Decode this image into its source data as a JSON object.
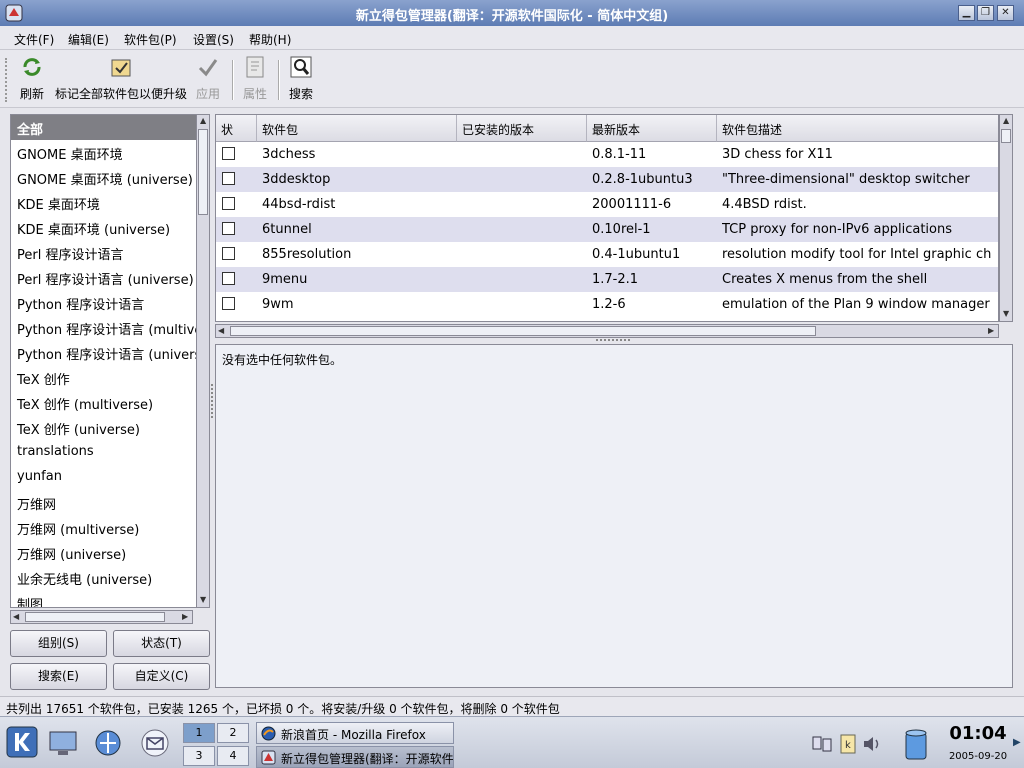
{
  "window": {
    "title": "新立得包管理器(翻译：开源软件国际化 - 简体中文组)"
  },
  "menu": [
    "文件(F)",
    "编辑(E)",
    "软件包(P)",
    "设置(S)",
    "帮助(H)"
  ],
  "toolbar": {
    "refresh": "刷新",
    "mark_all": "标记全部软件包以便升级",
    "apply": "应用",
    "properties": "属性",
    "search": "搜索"
  },
  "categories": [
    "全部",
    "GNOME 桌面环境",
    "GNOME 桌面环境 (universe)",
    "KDE 桌面环境",
    "KDE 桌面环境 (universe)",
    "Perl 程序设计语言",
    "Perl 程序设计语言 (universe)",
    "Python 程序设计语言",
    "Python 程序设计语言 (multiverse)",
    "Python 程序设计语言 (universe)",
    "TeX 创作",
    "TeX 创作 (multiverse)",
    "TeX 创作 (universe)",
    "translations",
    "yunfan",
    "万维网",
    "万维网 (multiverse)",
    "万维网 (universe)",
    "业余无线电 (universe)",
    "制图"
  ],
  "left_buttons": {
    "group": "组别(S)",
    "status": "状态(T)",
    "search": "搜索(E)",
    "custom": "自定义(C)"
  },
  "table": {
    "headers": [
      "状",
      "软件包",
      "已安装的版本",
      "最新版本",
      "软件包描述"
    ],
    "rows": [
      {
        "name": "3dchess",
        "installed": "",
        "latest": "0.8.1-11",
        "desc": "3D chess for X11"
      },
      {
        "name": "3ddesktop",
        "installed": "",
        "latest": "0.2.8-1ubuntu3",
        "desc": "\"Three-dimensional\" desktop switcher"
      },
      {
        "name": "44bsd-rdist",
        "installed": "",
        "latest": "20001111-6",
        "desc": "4.4BSD rdist."
      },
      {
        "name": "6tunnel",
        "installed": "",
        "latest": "0.10rel-1",
        "desc": "TCP proxy for non-IPv6 applications"
      },
      {
        "name": "855resolution",
        "installed": "",
        "latest": "0.4-1ubuntu1",
        "desc": "resolution modify tool for Intel graphic ch"
      },
      {
        "name": "9menu",
        "installed": "",
        "latest": "1.7-2.1",
        "desc": "Creates X menus from the shell"
      },
      {
        "name": "9wm",
        "installed": "",
        "latest": "1.2-6",
        "desc": "emulation of the Plan 9 window manager"
      }
    ]
  },
  "description": "没有选中任何软件包。",
  "status": "共列出 17651 个软件包，已安装 1265 个，已坏损 0 个。将安装/升级 0 个软件包，将删除 0 个软件包",
  "taskbar": {
    "pager": [
      "1",
      "2",
      "3",
      "4"
    ],
    "tasks": [
      {
        "label": "新浪首页 - Mozilla Firefox"
      },
      {
        "label": "新立得包管理器(翻译：开源软件国际化 - 简体中文组)"
      }
    ],
    "clock_time": "01:04",
    "clock_date": "2005-09-20"
  },
  "colors": {
    "titlebar": "#6f8bc0",
    "selected_category": "#7f7f85",
    "alt_row": "#dedeee"
  }
}
